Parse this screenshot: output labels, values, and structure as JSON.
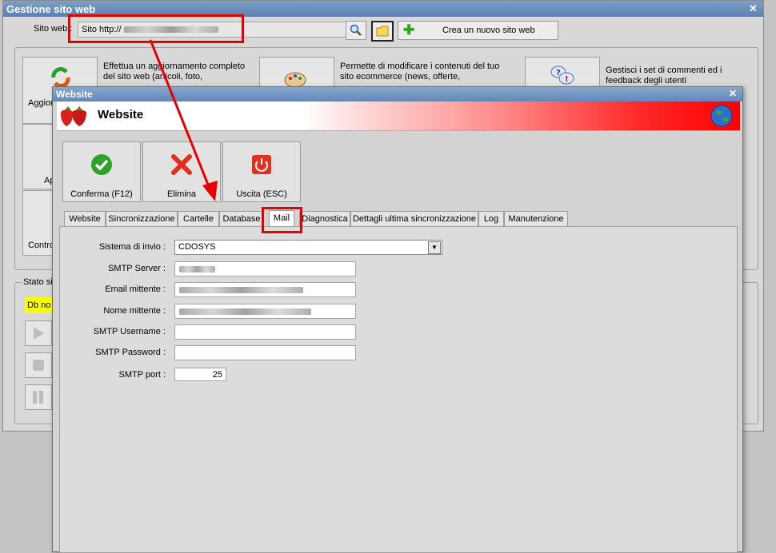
{
  "outer_window": {
    "title": "Gestione sito web",
    "site_label": "Sito web :",
    "site_prefix": "Sito http://",
    "new_site_label": "Crea un nuovo sito web",
    "tiles": [
      {
        "label": "Aggior",
        "description": "Effettua un aggiornamento completo del sito web (articoli, foto,"
      },
      {
        "label": "",
        "description": "Permette di modificare i contenuti del tuo sito ecommerce (news, offerte,"
      },
      {
        "label": "",
        "description": "Gestisci i set di commenti ed i feedback degli utenti"
      },
      {
        "label": "Ap",
        "description": ""
      },
      {
        "label": "Contro",
        "description": ""
      }
    ],
    "status_legend": "Stato sit",
    "db_badge": "Db no"
  },
  "dialog": {
    "title": "Website",
    "header_title": "Website",
    "buttons": {
      "confirm": "Conferma (F12)",
      "delete": "Elimina",
      "exit": "Uscita (ESC)"
    },
    "tabs": [
      "Website",
      "Sincronizzazione",
      "Cartelle",
      "Database",
      "Mail",
      "Diagnostica",
      "Dettagli ultima sincronizzazione",
      "Log",
      "Manutenzione"
    ],
    "active_tab": "Mail",
    "fields": {
      "send_system_label": "Sistema di invio :",
      "send_system_value": "CDOSYS",
      "smtp_server_label": "SMTP Server :",
      "sender_email_label": "Email mittente :",
      "sender_name_label": "Nome mittente :",
      "smtp_username_label": "SMTP Username :",
      "smtp_password_label": "SMTP Password :",
      "smtp_port_label": "SMTP port :",
      "smtp_port_value": "25"
    }
  },
  "colors": {
    "annotation_red": "#e60000",
    "title_blue": "#6387b8",
    "header_red": "#ff0000",
    "badge_yellow": "#ffff00"
  }
}
